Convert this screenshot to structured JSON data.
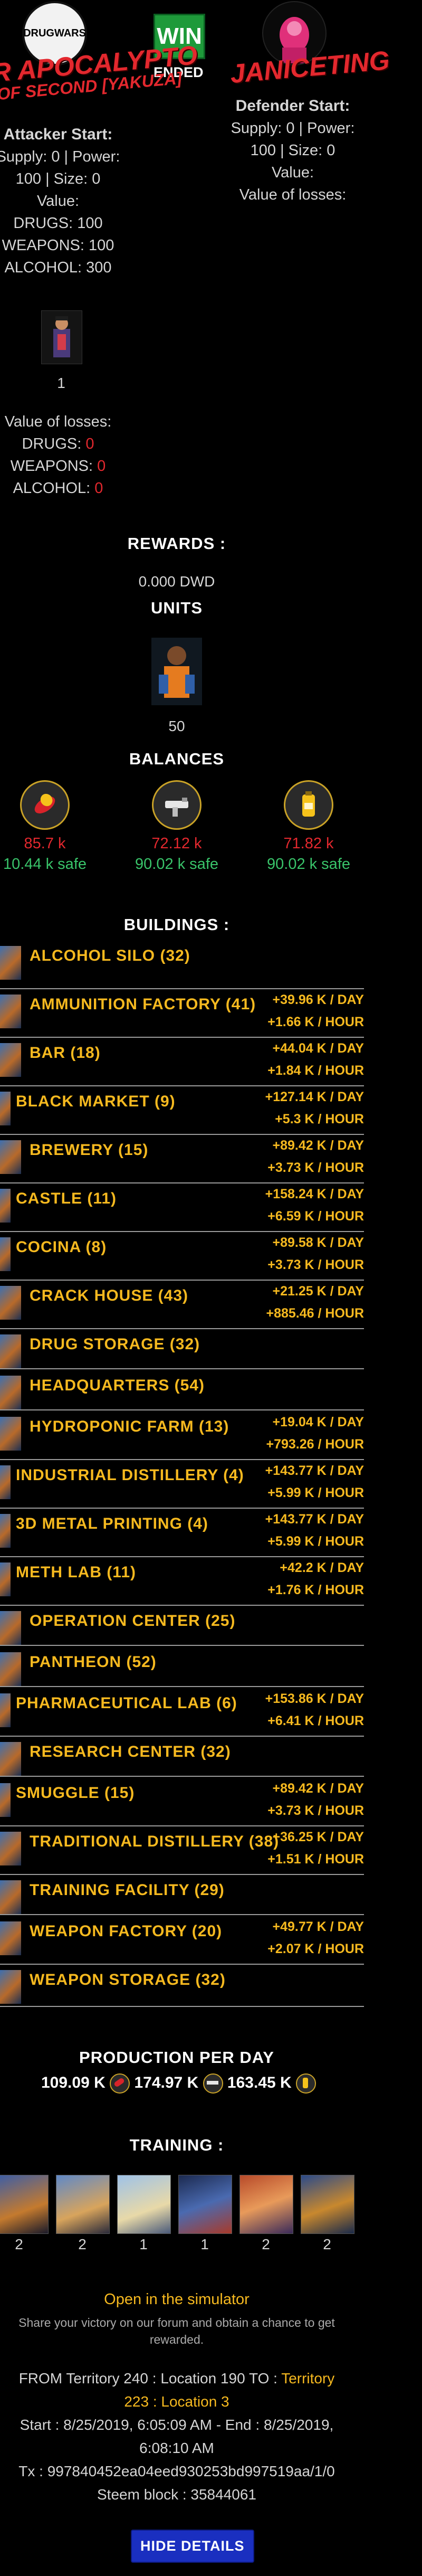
{
  "header": {
    "attacker_logo_text": "DRUGWARS",
    "result": "WIN",
    "status": "ENDED",
    "attacker_name": "R APOCALYPTO",
    "attacker_subtitle": "OF SECOND [YAKUZA]",
    "defender_name": "JANICETING"
  },
  "attacker": {
    "title": "Attacker Start:",
    "supply_line": "Supply: 0 | Power:",
    "power_line": "100 | Size: 0",
    "value_label": "Value:",
    "drugs": "DRUGS: 100",
    "weapons": "WEAPONS: 100",
    "alcohol": "ALCOHOL: 300",
    "unit_count": "1",
    "losses_label": "Value of losses:",
    "losses_drugs_label": "DRUGS:",
    "losses_drugs": "0",
    "losses_weapons_label": "WEAPONS:",
    "losses_weapons": "0",
    "losses_alcohol_label": "ALCOHOL:",
    "losses_alcohol": "0"
  },
  "defender": {
    "title": "Defender Start:",
    "supply_line": "Supply: 0 | Power:",
    "power_line": "100 | Size: 0",
    "value_label": "Value:",
    "losses_label": "Value of losses:"
  },
  "rewards": {
    "title": "REWARDS :",
    "value": "0.000 DWD",
    "units_title": "UNITS",
    "unit_count": "50"
  },
  "balances": {
    "title": "BALANCES",
    "items": [
      {
        "amount": "85.7 k",
        "safe": "10.44 k safe",
        "icon": "drugs-icon"
      },
      {
        "amount": "72.12 k",
        "safe": "90.02 k safe",
        "icon": "weapons-icon"
      },
      {
        "amount": "71.82 k",
        "safe": "90.02 k safe",
        "icon": "alcohol-icon"
      }
    ]
  },
  "buildings": {
    "title": "BUILDINGS :",
    "items": [
      {
        "name": "ALCOHOL SILO (32)",
        "day": "",
        "hour": ""
      },
      {
        "name": "AMMUNITION FACTORY (41)",
        "day": "+39.96 K / DAY",
        "hour": "+1.66 K / HOUR"
      },
      {
        "name": "BAR (18)",
        "day": "+44.04 K / DAY",
        "hour": "+1.84 K / HOUR"
      },
      {
        "name": "BLACK MARKET (9)",
        "day": "+127.14 K / DAY",
        "hour": "+5.3 K / HOUR"
      },
      {
        "name": "BREWERY (15)",
        "day": "+89.42 K / DAY",
        "hour": "+3.73 K / HOUR"
      },
      {
        "name": "CASTLE (11)",
        "day": "+158.24 K / DAY",
        "hour": "+6.59 K / HOUR"
      },
      {
        "name": "COCINA (8)",
        "day": "+89.58 K / DAY",
        "hour": "+3.73 K / HOUR"
      },
      {
        "name": "CRACK HOUSE (43)",
        "day": "+21.25 K / DAY",
        "hour": "+885.46 / HOUR"
      },
      {
        "name": "DRUG STORAGE (32)",
        "day": "",
        "hour": ""
      },
      {
        "name": "HEADQUARTERS (54)",
        "day": "",
        "hour": ""
      },
      {
        "name": "HYDROPONIC FARM (13)",
        "day": "+19.04 K / DAY",
        "hour": "+793.26 / HOUR"
      },
      {
        "name": "INDUSTRIAL DISTILLERY (4)",
        "day": "+143.77 K / DAY",
        "hour": "+5.99 K / HOUR"
      },
      {
        "name": "3D METAL PRINTING (4)",
        "day": "+143.77 K / DAY",
        "hour": "+5.99 K / HOUR"
      },
      {
        "name": "METH LAB (11)",
        "day": "+42.2 K / DAY",
        "hour": "+1.76 K / HOUR"
      },
      {
        "name": "OPERATION CENTER (25)",
        "day": "",
        "hour": ""
      },
      {
        "name": "PANTHEON (52)",
        "day": "",
        "hour": ""
      },
      {
        "name": "PHARMACEUTICAL LAB (6)",
        "day": "+153.86 K / DAY",
        "hour": "+6.41 K / HOUR"
      },
      {
        "name": "RESEARCH CENTER (32)",
        "day": "",
        "hour": ""
      },
      {
        "name": "SMUGGLE (15)",
        "day": "+89.42 K / DAY",
        "hour": "+3.73 K / HOUR"
      },
      {
        "name": "TRADITIONAL DISTILLERY (38)",
        "day": "+36.25 K / DAY",
        "hour": "+1.51 K / HOUR"
      },
      {
        "name": "TRAINING FACILITY (29)",
        "day": "",
        "hour": ""
      },
      {
        "name": "WEAPON FACTORY (20)",
        "day": "+49.77 K / DAY",
        "hour": "+2.07 K / HOUR"
      },
      {
        "name": "WEAPON STORAGE (32)",
        "day": "",
        "hour": ""
      }
    ]
  },
  "production": {
    "title": "PRODUCTION PER DAY",
    "drugs": "109.09 K",
    "weapons": "174.97 K",
    "alcohol": "163.45 K"
  },
  "training": {
    "title": "TRAINING :",
    "counts": [
      "2",
      "2",
      "1",
      "1",
      "2",
      "2"
    ]
  },
  "footer": {
    "simulator_link": "Open in the simulator",
    "share_line1": "Share your victory on our forum and obtain a chance to get",
    "share_line2": "rewarded.",
    "route_prefix": "FROM Territory 240 : Location 190 TO :",
    "route_to_a": "Territory",
    "route_to_b": "223 : Location 3",
    "start_end_1": "Start : 8/25/2019, 6:05:09 AM - End : 8/25/2019,",
    "start_end_2": "6:08:10 AM",
    "tx": "Tx : 997840452ea04eed930253bd997519aa/1/0",
    "block": "Steem block : 35844061",
    "hide_button": "HIDE DETAILS"
  }
}
